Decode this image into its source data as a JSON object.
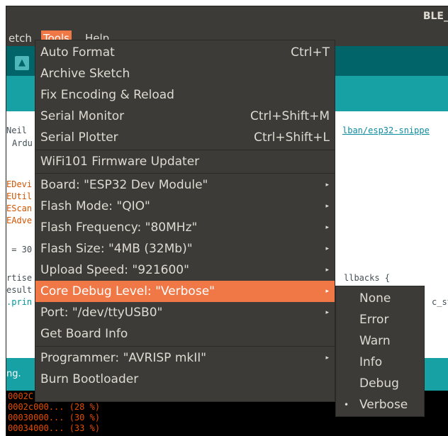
{
  "window": {
    "title": "BLE_"
  },
  "menubar": {
    "items": [
      {
        "label": "etch",
        "mnemonic": ""
      },
      {
        "label": "ools",
        "mnemonic": "T"
      },
      {
        "label": "elp",
        "mnemonic": "H"
      }
    ]
  },
  "editor": {
    "lines": [
      "Neil",
      "Ardu",
      "lban/esp32-snippe",
      "EDevi",
      "EUtil",
      "EScan",
      "EAdve",
      " = 30",
      "rtise",
      "llbacks {",
      "esult",
      ".prin",
      "c_st"
    ]
  },
  "statusbar": {
    "text": "ng."
  },
  "console": {
    "lines": [
      "0002C",
      "0002c000... (28 %)",
      "00030000... (30 %)",
      "00034000... (33 %)"
    ]
  },
  "tools_menu": {
    "items": [
      {
        "label": "Auto Format",
        "accel": "Ctrl+T"
      },
      {
        "label": "Archive Sketch",
        "accel": ""
      },
      {
        "label": "Fix Encoding & Reload",
        "accel": ""
      },
      {
        "label": "Serial Monitor",
        "accel": "Ctrl+Shift+M"
      },
      {
        "label": "Serial Plotter",
        "accel": "Ctrl+Shift+L"
      },
      {
        "label": "WiFi101 Firmware Updater",
        "accel": ""
      },
      {
        "label": "Board: \"ESP32 Dev Module\"",
        "accel": ""
      },
      {
        "label": "Flash Mode: \"QIO\"",
        "accel": ""
      },
      {
        "label": "Flash Frequency: \"80MHz\"",
        "accel": ""
      },
      {
        "label": "Flash Size: \"4MB (32Mb)\"",
        "accel": ""
      },
      {
        "label": "Upload Speed: \"921600\"",
        "accel": ""
      },
      {
        "label": "Core Debug Level: \"Verbose\"",
        "accel": ""
      },
      {
        "label": "Port: \"/dev/ttyUSB0\"",
        "accel": ""
      },
      {
        "label": "Get Board Info",
        "accel": ""
      },
      {
        "label": "Programmer: \"AVRISP mkII\"",
        "accel": ""
      },
      {
        "label": "Burn Bootloader",
        "accel": ""
      }
    ],
    "submenu_arrow": "▸"
  },
  "debug_submenu": {
    "items": [
      "None",
      "Error",
      "Warn",
      "Info",
      "Debug",
      "Verbose"
    ],
    "selected": "Verbose",
    "bullet": "•"
  },
  "colors": {
    "menu_bg": "#3c3b37",
    "highlight": "#f07746",
    "toolbar": "#006468",
    "tabbar": "#17a1a5"
  },
  "icons": {
    "toolbar_upload": "upload-arrow-icon"
  }
}
